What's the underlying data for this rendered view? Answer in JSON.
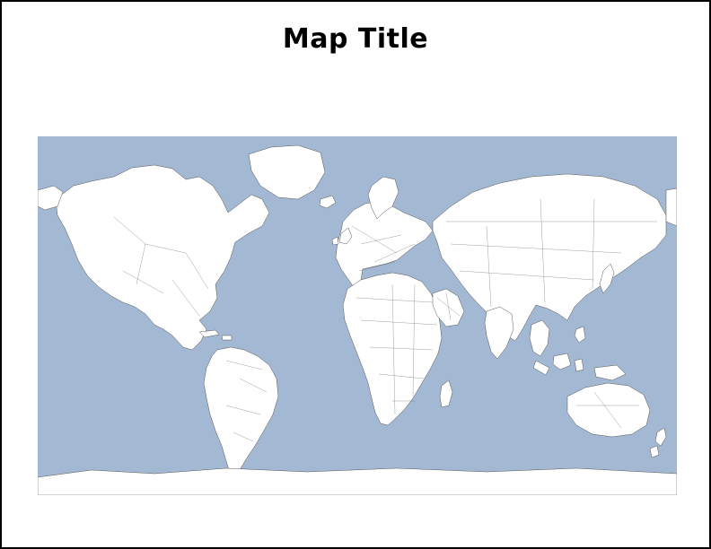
{
  "title": "Map Title",
  "map": {
    "projection": "equirectangular",
    "extent": {
      "lon_min": -180,
      "lon_max": 180,
      "lat_min": -90,
      "lat_max": 90
    },
    "ocean_color": "#a3b8d3",
    "land_fill": "#ffffff",
    "country_border_color": "#777777",
    "coastline_color": "#555555",
    "countries_shown": "all world countries, outlined with thin grey borders, no fill color differentiation",
    "data_overlay": "none"
  }
}
